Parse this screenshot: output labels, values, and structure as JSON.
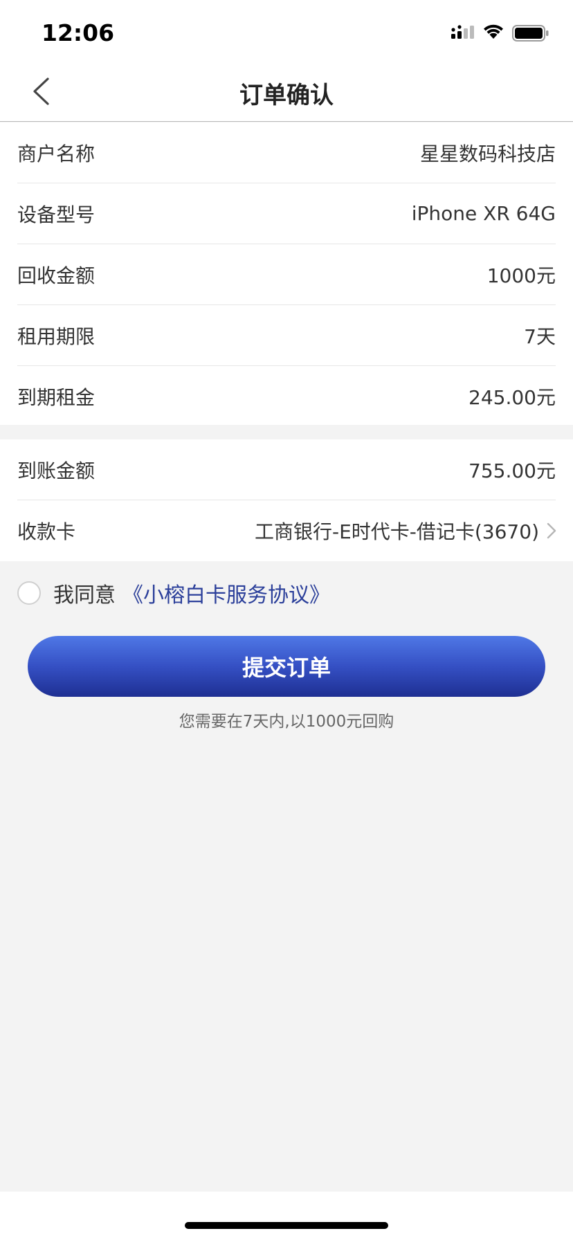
{
  "status_bar": {
    "time": "12:06"
  },
  "nav": {
    "title": "订单确认",
    "back_icon": "chevron-left-icon"
  },
  "order_info": [
    {
      "label": "商户名称",
      "value": "星星数码科技店"
    },
    {
      "label": "设备型号",
      "value": "iPhone XR 64G"
    },
    {
      "label": "回收金额",
      "value": "1000元"
    },
    {
      "label": "租用期限",
      "value": "7天"
    },
    {
      "label": "到期租金",
      "value": "245.00元"
    }
  ],
  "payout": {
    "amount_label": "到账金额",
    "amount_value": "755.00元",
    "card_label": "收款卡",
    "card_value": "工商银行-E时代卡-借记卡(3670)"
  },
  "agreement": {
    "text": "我同意",
    "link": "《小榕白卡服务协议》",
    "checked": false
  },
  "submit": {
    "label": "提交订单"
  },
  "hint": "您需要在7天内,以1000元回购",
  "colors": {
    "accent": "#3550c4",
    "link": "#2b3f9a",
    "background": "#f3f3f3"
  }
}
